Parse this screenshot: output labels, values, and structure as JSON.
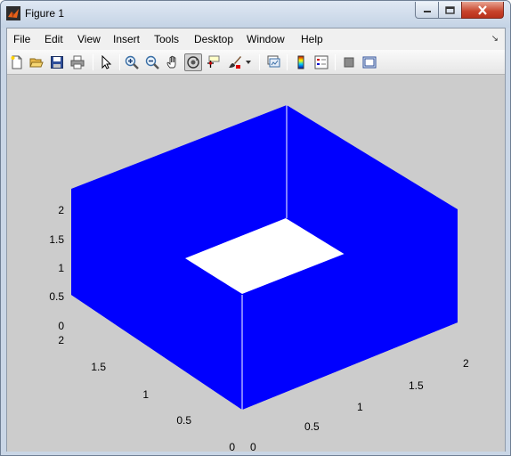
{
  "window": {
    "title": "Figure 1",
    "controls": [
      "minimize",
      "maximize",
      "close"
    ]
  },
  "menu": {
    "items": [
      "File",
      "Edit",
      "View",
      "Insert",
      "Tools",
      "Desktop",
      "Window",
      "Help"
    ]
  },
  "toolbar": {
    "buttons": [
      {
        "name": "new-figure",
        "icon": "new-page-icon"
      },
      {
        "name": "open-file",
        "icon": "folder-open-icon"
      },
      {
        "name": "save-figure",
        "icon": "floppy-disk-icon"
      },
      {
        "name": "print-figure",
        "icon": "printer-icon"
      },
      {
        "name": "edit-plot",
        "icon": "arrow-cursor-icon"
      },
      {
        "name": "zoom-in",
        "icon": "zoom-in-icon"
      },
      {
        "name": "zoom-out",
        "icon": "zoom-out-icon"
      },
      {
        "name": "pan",
        "icon": "hand-icon"
      },
      {
        "name": "rotate-3d",
        "icon": "rotate-3d-icon",
        "pressed": true
      },
      {
        "name": "data-cursor",
        "icon": "data-cursor-icon"
      },
      {
        "name": "brush",
        "icon": "brush-icon"
      },
      {
        "name": "link-plot",
        "icon": "link-plot-icon"
      },
      {
        "name": "insert-colorbar",
        "icon": "colorbar-icon"
      },
      {
        "name": "insert-legend",
        "icon": "legend-icon"
      },
      {
        "name": "hide-plot-tools",
        "icon": "hide-tools-icon"
      },
      {
        "name": "show-plot-tools",
        "icon": "show-tools-icon"
      }
    ]
  },
  "axes": {
    "colors": {
      "surface": "#0000ff",
      "hole": "#ffffff",
      "background": "#cccccc",
      "edge": "#ffffff"
    },
    "z_ticks": [
      "0",
      "0.5",
      "1",
      "1.5",
      "2"
    ],
    "y_ticks_left": [
      "0",
      "0.5",
      "1",
      "1.5",
      "2"
    ],
    "x_ticks_right": [
      "0",
      "0.5",
      "1",
      "1.5",
      "2"
    ]
  }
}
